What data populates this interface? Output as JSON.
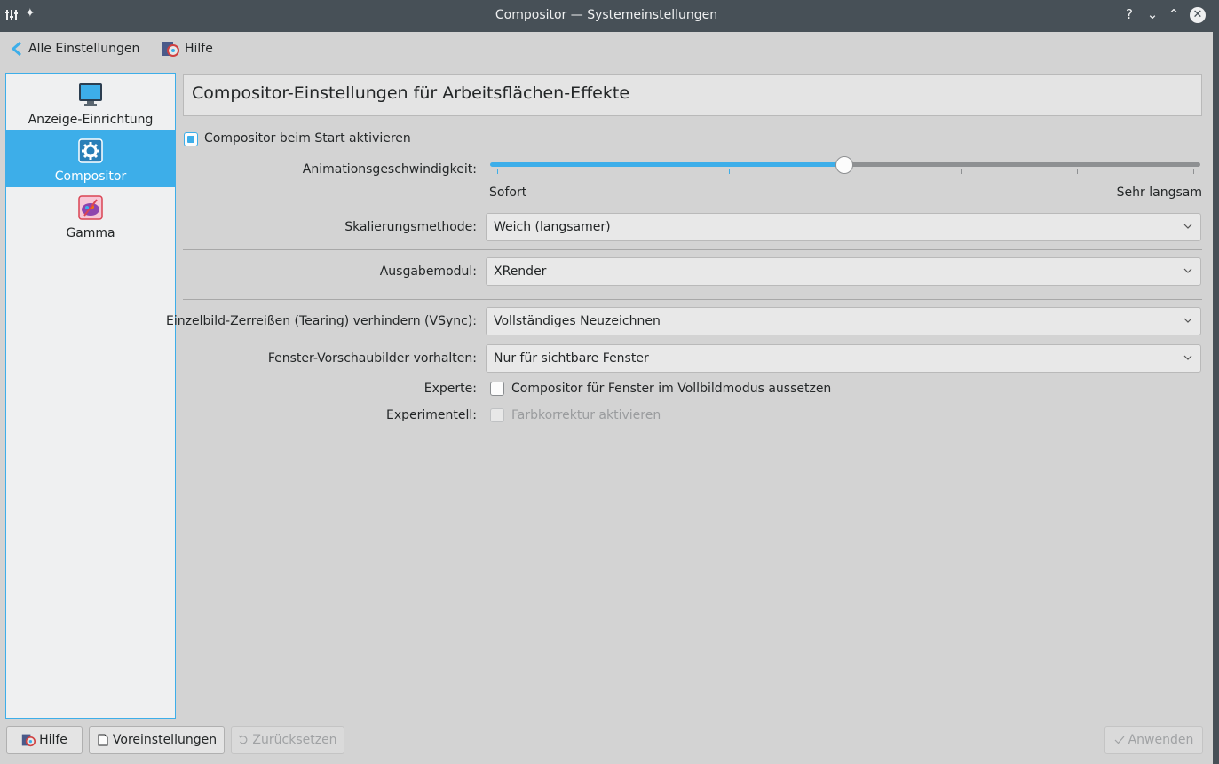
{
  "window": {
    "title": "Compositor — Systemeinstellungen",
    "controls": {
      "help": "?",
      "minimize": "⌄",
      "maximize": "⌃",
      "close": "✕"
    }
  },
  "toolbar": {
    "back_label": "Alle Einstellungen",
    "help_label": "Hilfe"
  },
  "sidebar": {
    "items": [
      {
        "label": "Anzeige-Einrichtung",
        "icon": "monitor-icon"
      },
      {
        "label": "Compositor",
        "icon": "gear-icon",
        "active": true
      },
      {
        "label": "Gamma",
        "icon": "palette-icon"
      }
    ]
  },
  "main": {
    "header": "Compositor-Einstellungen für Arbeitsflächen-Effekte",
    "enable_on_start": {
      "label": "Compositor beim Start aktivieren",
      "checked": true
    },
    "animation_speed": {
      "label": "Animationsgeschwindigkeit:",
      "min_label": "Sofort",
      "max_label": "Sehr langsam",
      "value_fraction": 0.5
    },
    "scaling": {
      "label": "Skalierungsmethode:",
      "value": "Weich (langsamer)"
    },
    "backend": {
      "label": "Ausgabemodul:",
      "value": "XRender"
    },
    "vsync": {
      "label": "Einzelbild-Zerreißen (Tearing) verhindern (VSync):",
      "value": "Vollständiges Neuzeichnen"
    },
    "thumbnails": {
      "label": "Fenster-Vorschaubilder vorhalten:",
      "value": "Nur für sichtbare Fenster"
    },
    "expert": {
      "label": "Experte:",
      "option": "Compositor für Fenster im Vollbildmodus aussetzen",
      "checked": false
    },
    "experimental": {
      "label": "Experimentell:",
      "option": "Farbkorrektur aktivieren",
      "checked": false,
      "disabled": true
    }
  },
  "footer": {
    "help": "Hilfe",
    "defaults": "Voreinstellungen",
    "reset": "Zurücksetzen",
    "apply": "Anwenden"
  },
  "colors": {
    "accent": "#3daee9",
    "titlebar": "#475057",
    "background": "#d3d3d3"
  }
}
